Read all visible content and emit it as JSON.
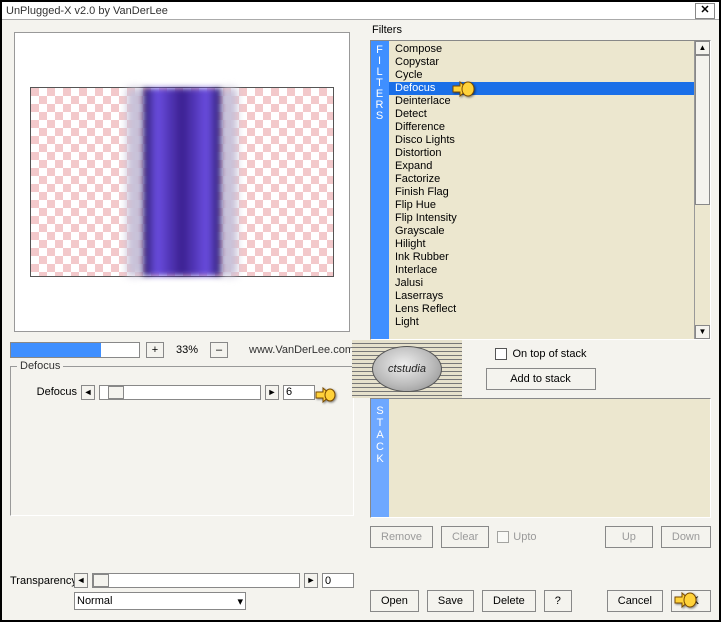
{
  "window": {
    "title": "UnPlugged-X v2.0 by VanDerLee"
  },
  "preview": {
    "zoom_pct": "33%",
    "url": "www.VanDerLee.com"
  },
  "defocus": {
    "group_label": "Defocus",
    "param_label": "Defocus",
    "value": "6"
  },
  "transparency": {
    "label": "Transparency",
    "value": "0",
    "blend_mode": "Normal"
  },
  "filters": {
    "heading": "Filters",
    "tab": "FILTERS",
    "selected_index": 3,
    "items": [
      "Compose",
      "Copystar",
      "Cycle",
      "Defocus",
      "Deinterlace",
      "Detect",
      "Difference",
      "Disco Lights",
      "Distortion",
      "Expand",
      "Factorize",
      "Finish Flag",
      "Flip Hue",
      "Flip Intensity",
      "Grayscale",
      "Hilight",
      "Ink Rubber",
      "Interlace",
      "Jalusi",
      "Laserrays",
      "Lens Reflect",
      "Light"
    ]
  },
  "ontop": {
    "label": "On top of stack",
    "checked": false
  },
  "stack": {
    "tab": "STACK",
    "add_label": "Add to stack",
    "buttons": {
      "remove": "Remove",
      "clear": "Clear",
      "upto": "Upto",
      "up": "Up",
      "down": "Down"
    }
  },
  "bottom_buttons": {
    "open": "Open",
    "save": "Save",
    "delete": "Delete",
    "help": "?",
    "cancel": "Cancel",
    "ok": "OK"
  },
  "logo_text": "ctstudia"
}
